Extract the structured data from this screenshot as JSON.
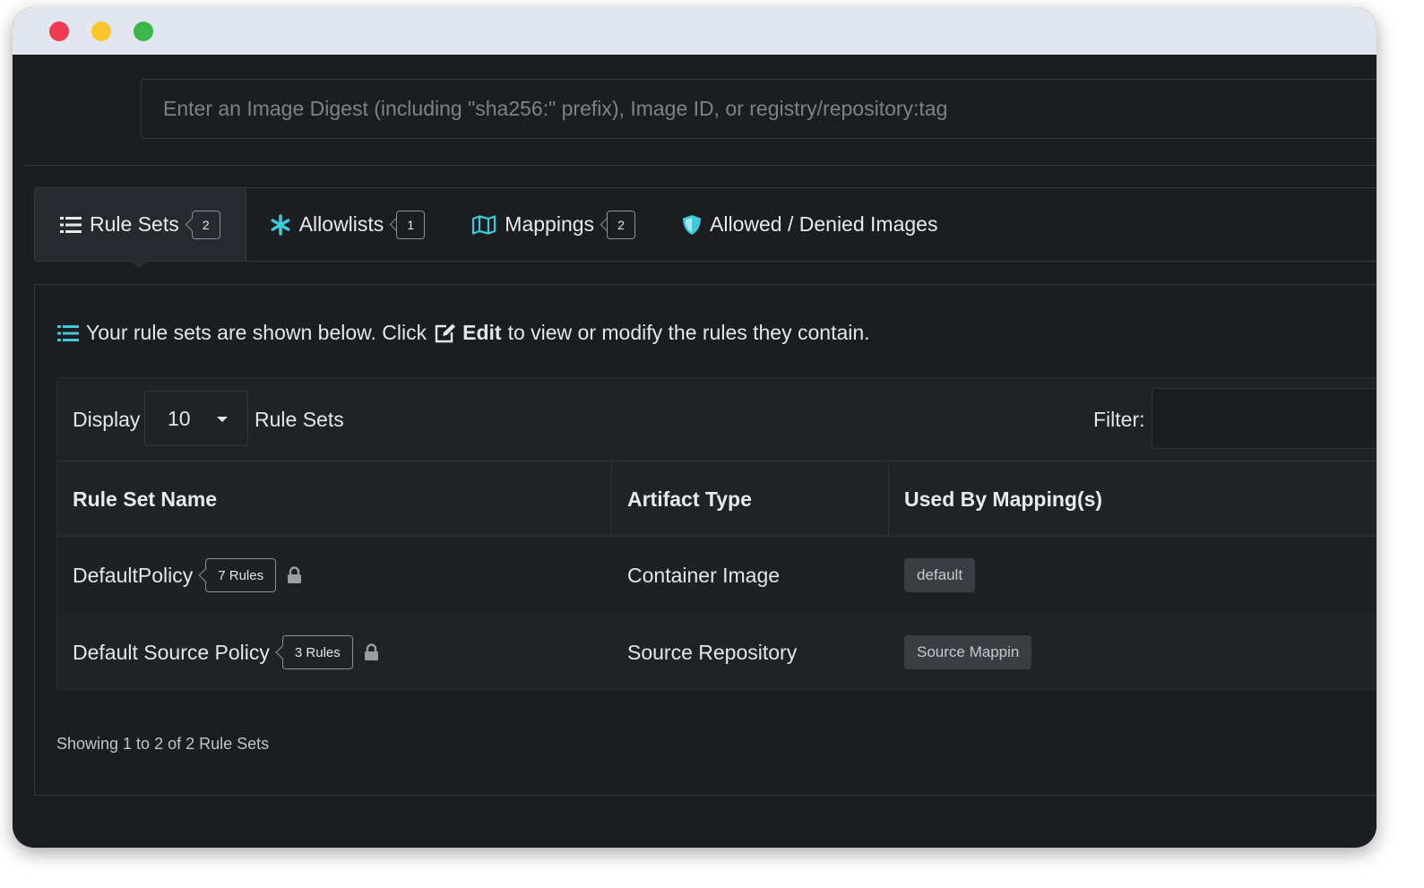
{
  "search": {
    "placeholder": "Enter an Image Digest (including \"sha256:\" prefix), Image ID, or registry/repository:tag"
  },
  "tabs": [
    {
      "label": "Rule Sets",
      "badge": "2",
      "icon": "list-icon"
    },
    {
      "label": "Allowlists",
      "badge": "1",
      "icon": "asterisk-icon"
    },
    {
      "label": "Mappings",
      "badge": "2",
      "icon": "map-icon"
    },
    {
      "label": "Allowed / Denied Images",
      "icon": "shield-icon"
    }
  ],
  "intro": {
    "prefix": "Your rule sets are shown below. Click",
    "edit": "Edit",
    "suffix": "to view or modify the rules they contain."
  },
  "toolbar": {
    "display_label": "Display",
    "page_size": "10",
    "rulesets_label": "Rule Sets",
    "filter_label": "Filter:"
  },
  "table": {
    "headers": [
      "Rule Set Name",
      "Artifact Type",
      "Used By Mapping(s)"
    ],
    "rows": [
      {
        "name": "DefaultPolicy",
        "rules": "7 Rules",
        "type": "Container Image",
        "mapping": "default"
      },
      {
        "name": "Default Source Policy",
        "rules": "3 Rules",
        "type": "Source Repository",
        "mapping": "Source Mappin"
      }
    ]
  },
  "footer": "Showing 1 to 2 of 2 Rule Sets",
  "colors": {
    "accent": "#3ec8d8",
    "background": "#1b1d20",
    "border": "#34373b"
  }
}
